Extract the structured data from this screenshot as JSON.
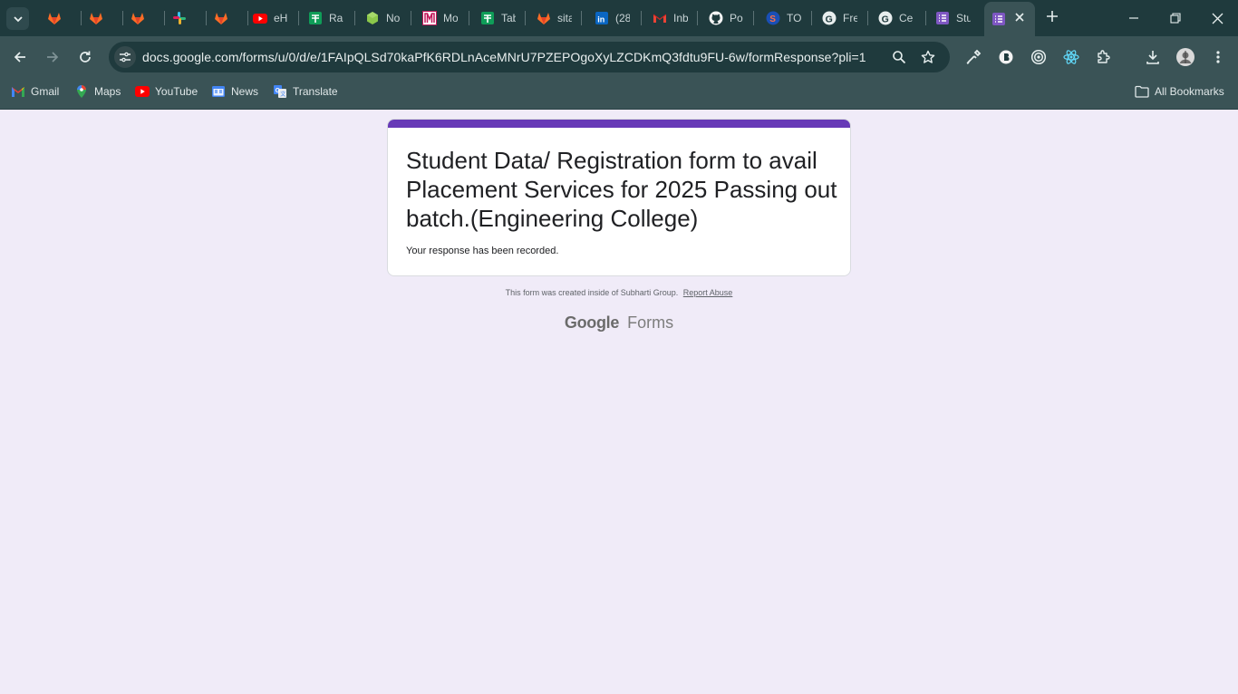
{
  "tabs": [
    {
      "title": "",
      "icon": "gitlab-icon"
    },
    {
      "title": "",
      "icon": "gitlab-icon"
    },
    {
      "title": "",
      "icon": "gitlab-icon"
    },
    {
      "title": "",
      "icon": "slack-icon"
    },
    {
      "title": "",
      "icon": "gitlab-icon"
    },
    {
      "title": "eH",
      "icon": "youtube-icon"
    },
    {
      "title": "Ra",
      "icon": "sheets-icon"
    },
    {
      "title": "No",
      "icon": "nodejs-icon"
    },
    {
      "title": "Mo",
      "icon": "m-icon"
    },
    {
      "title": "Tab",
      "icon": "sheets-icon"
    },
    {
      "title": "sita",
      "icon": "gitlab-icon"
    },
    {
      "title": "(28",
      "icon": "linkedin-icon"
    },
    {
      "title": "Inb",
      "icon": "gmail-icon"
    },
    {
      "title": "Po",
      "icon": "github-icon"
    },
    {
      "title": "TO",
      "icon": "s-icon"
    },
    {
      "title": "Fre",
      "icon": "google-icon"
    },
    {
      "title": "Ce",
      "icon": "google-icon"
    },
    {
      "title": "Stu",
      "icon": "forms-icon"
    }
  ],
  "address_bar": {
    "url": "docs.google.com/forms/u/0/d/e/1FAIpQLSd70kaPfK6RDLnAceMNrU7PZEPOgoXyLZCDKmQ3fdtu9FU-6w/formResponse?pli=1"
  },
  "bookmarks": {
    "items": [
      {
        "label": "Gmail"
      },
      {
        "label": "Maps"
      },
      {
        "label": "YouTube"
      },
      {
        "label": "News"
      },
      {
        "label": "Translate"
      }
    ],
    "all_bookmarks": "All Bookmarks"
  },
  "form": {
    "title": "Student Data/ Registration form to avail Placement Services for 2025 Passing out batch.(Engineering College)",
    "confirmation": "Your response has been recorded.",
    "accent_color": "#673ab7"
  },
  "footer": {
    "note": "This form was created inside of Subharti Group.",
    "report_link": "Report Abuse",
    "brand_google": "Google",
    "brand_forms": "Forms"
  }
}
